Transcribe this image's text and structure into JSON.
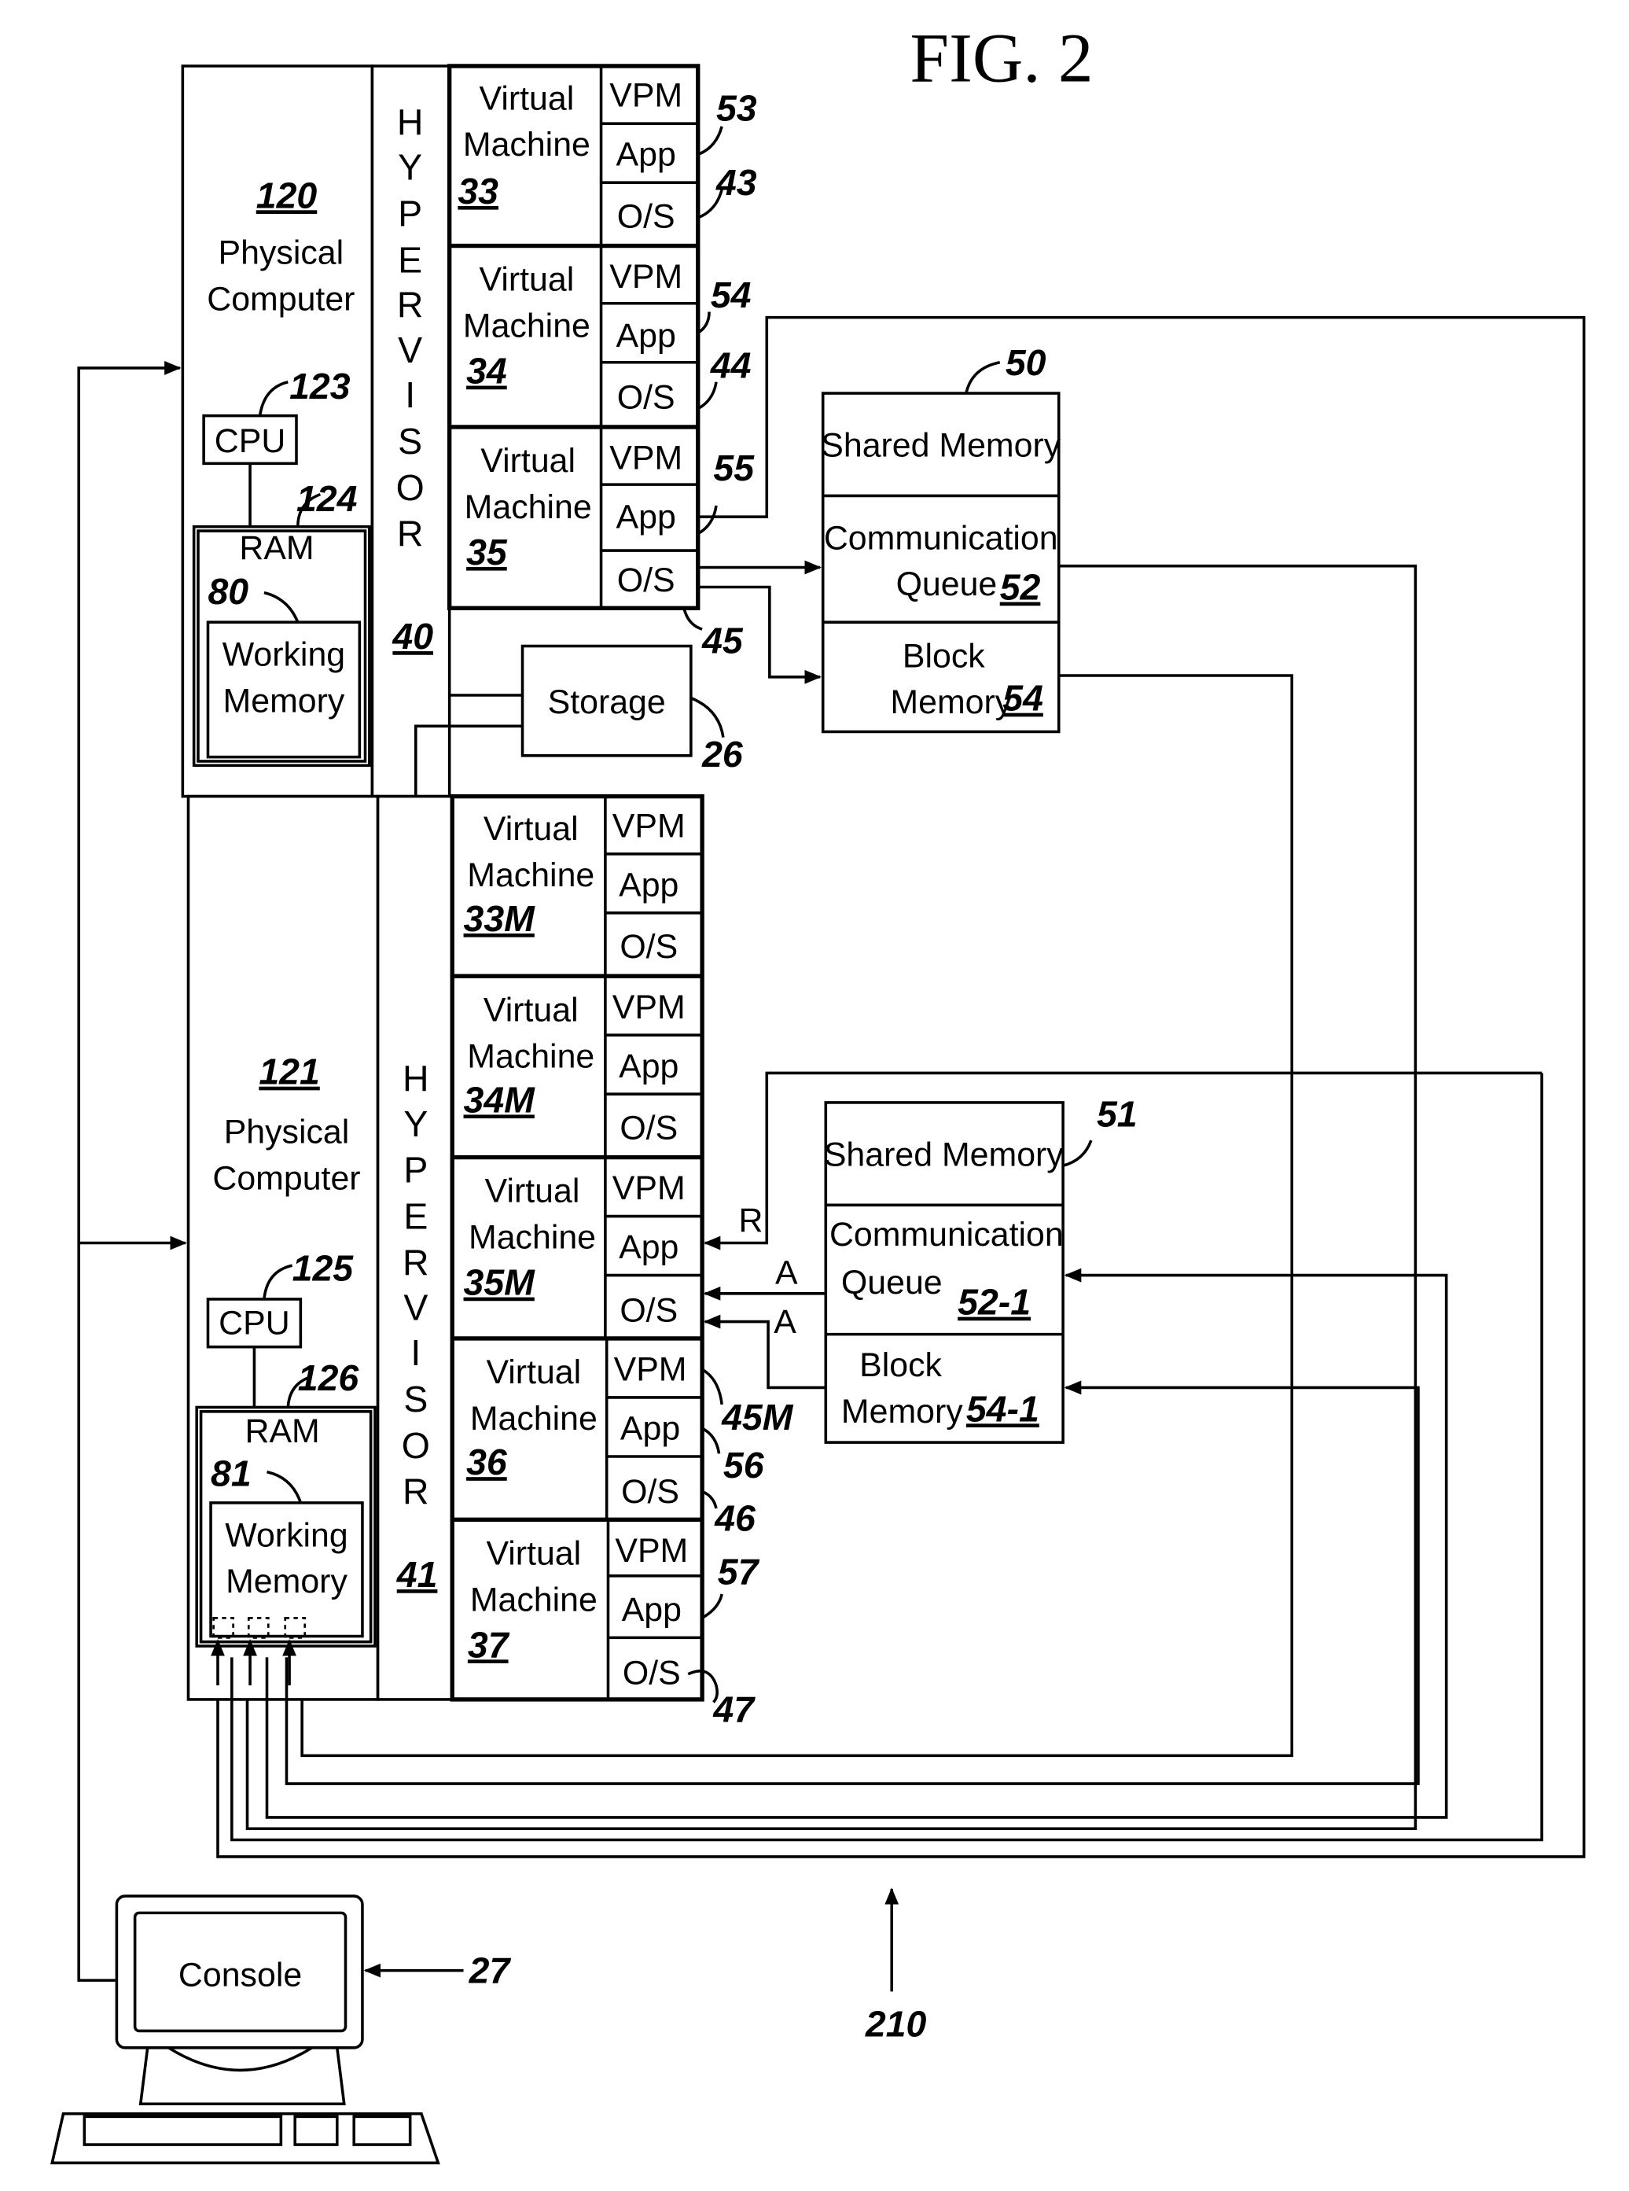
{
  "figure": {
    "title": "FIG. 2",
    "system_ref": "210"
  },
  "computers": [
    {
      "ref": "120",
      "label_line1": "Physical",
      "label_line2": "Computer",
      "cpu": "CPU",
      "cpu_ref": "123",
      "ram": "RAM",
      "ram_ref": "124",
      "wm_ref": "80",
      "wm_line1": "Working",
      "wm_line2": "Memory",
      "hypervisor_letters": [
        "H",
        "Y",
        "P",
        "E",
        "R",
        "V",
        "I",
        "S",
        "O",
        "R"
      ],
      "hypervisor_ref": "40"
    },
    {
      "ref": "121",
      "label_line1": "Physical",
      "label_line2": "Computer",
      "cpu": "CPU",
      "cpu_ref": "125",
      "ram": "RAM",
      "ram_ref": "126",
      "wm_ref": "81",
      "wm_line1": "Working",
      "wm_line2": "Memory",
      "hypervisor_letters": [
        "H",
        "Y",
        "P",
        "E",
        "R",
        "V",
        "I",
        "S",
        "O",
        "R"
      ],
      "hypervisor_ref": "41"
    }
  ],
  "vm_labels": {
    "line1": "Virtual",
    "line2": "Machine",
    "vpm": "VPM",
    "app": "App",
    "os": "O/S"
  },
  "vms_top": [
    {
      "ref": "33",
      "app_ref": "53",
      "os_ref": "43"
    },
    {
      "ref": "34",
      "app_ref": "54",
      "os_ref": "44"
    },
    {
      "ref": "35",
      "app_ref": "55",
      "os_ref": "45"
    }
  ],
  "vms_bottom": [
    {
      "ref": "33M"
    },
    {
      "ref": "34M"
    },
    {
      "ref": "35M"
    },
    {
      "ref": "36",
      "vpm_ref": "45M",
      "app_ref": "56",
      "os_ref": "46"
    },
    {
      "ref": "37",
      "app_ref": "57",
      "os_ref": "47"
    }
  ],
  "storage": {
    "label": "Storage",
    "ref": "26"
  },
  "shared_top": {
    "ref": "50",
    "shared": "Shared Memory",
    "cq_line1": "Communication",
    "cq_line2": "Queue",
    "cq_ref": "52",
    "bm_line1": "Block",
    "bm_line2": "Memory",
    "bm_ref": "54"
  },
  "shared_bottom": {
    "ref": "51",
    "shared": "Shared Memory",
    "cq_line1": "Communication",
    "cq_line2": "Queue",
    "cq_ref": "52-1",
    "bm_line1": "Block",
    "bm_line2": "Memory",
    "bm_ref": "54-1"
  },
  "signals": {
    "r": "R",
    "a1": "A",
    "a2": "A"
  },
  "console": {
    "label": "Console",
    "ref": "27"
  }
}
